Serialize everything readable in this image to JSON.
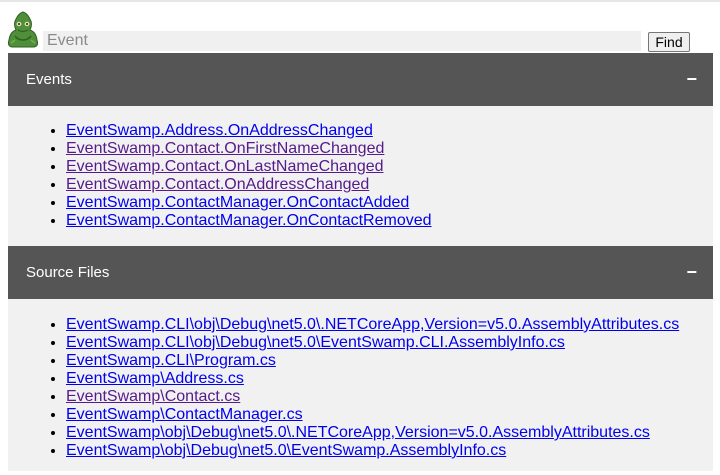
{
  "search": {
    "placeholder": "Event",
    "find_label": "Find"
  },
  "sections": [
    {
      "title": "Events",
      "toggle": "−",
      "links": [
        {
          "text": "EventSwamp.Address.OnAddressChanged",
          "visited": false
        },
        {
          "text": "EventSwamp.Contact.OnFirstNameChanged",
          "visited": true
        },
        {
          "text": "EventSwamp.Contact.OnLastNameChanged",
          "visited": true
        },
        {
          "text": "EventSwamp.Contact.OnAddressChanged",
          "visited": true
        },
        {
          "text": "EventSwamp.ContactManager.OnContactAdded",
          "visited": false
        },
        {
          "text": "EventSwamp.ContactManager.OnContactRemoved",
          "visited": false
        }
      ]
    },
    {
      "title": "Source Files",
      "toggle": "−",
      "links": [
        {
          "text": "EventSwamp.CLI\\obj\\Debug\\net5.0\\.NETCoreApp,Version=v5.0.AssemblyAttributes.cs",
          "visited": false
        },
        {
          "text": "EventSwamp.CLI\\obj\\Debug\\net5.0\\EventSwamp.CLI.AssemblyInfo.cs",
          "visited": false
        },
        {
          "text": "EventSwamp.CLI\\Program.cs",
          "visited": false
        },
        {
          "text": "EventSwamp\\Address.cs",
          "visited": false
        },
        {
          "text": "EventSwamp\\Contact.cs",
          "visited": true
        },
        {
          "text": "EventSwamp\\ContactManager.cs",
          "visited": false
        },
        {
          "text": "EventSwamp\\obj\\Debug\\net5.0\\.NETCoreApp,Version=v5.0.AssemblyAttributes.cs",
          "visited": false
        },
        {
          "text": "EventSwamp\\obj\\Debug\\net5.0\\EventSwamp.AssemblyInfo.cs",
          "visited": false
        }
      ]
    }
  ],
  "logo_icon": "swamp-monster-logo-icon"
}
